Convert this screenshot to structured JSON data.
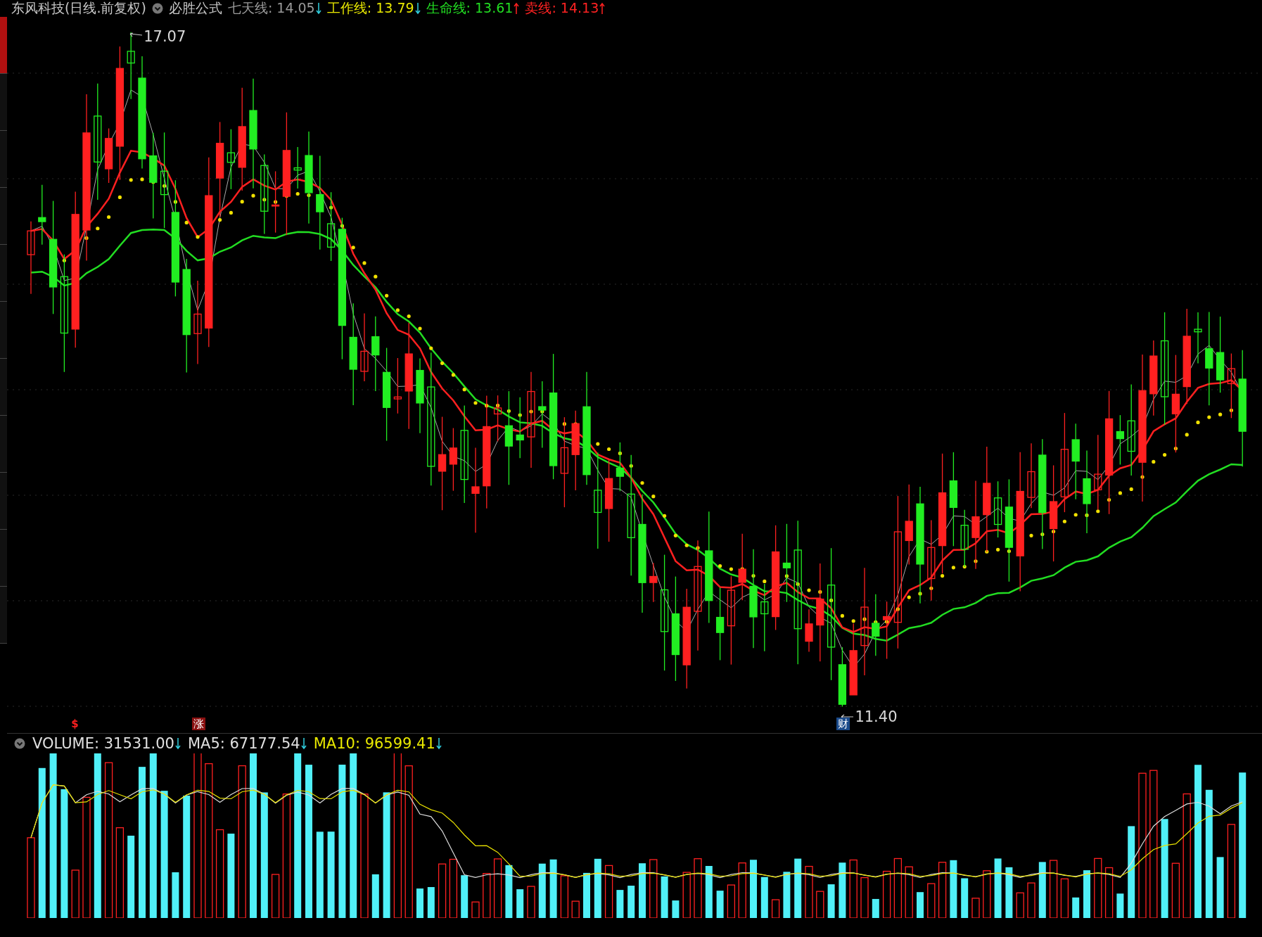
{
  "header": {
    "title": "东风科技(日线.前复权)",
    "indicator": "必胜公式",
    "readings": [
      {
        "label": "七天线: 14.05",
        "rising": false,
        "color": "#9a9a9a"
      },
      {
        "label": "工作线: 13.79",
        "rising": false,
        "color": "#e8e800"
      },
      {
        "label": "生命线: 13.61",
        "rising": true,
        "color": "#22dd22"
      },
      {
        "label": "卖线: 14.13",
        "rising": true,
        "color": "#ff2222"
      }
    ]
  },
  "price_chart": {
    "high_label": "17.07",
    "low_label": "11.40",
    "markers": [
      {
        "text": "$",
        "kind": "signal"
      },
      {
        "text": "涨",
        "kind": "limit"
      },
      {
        "text": "财",
        "kind": "report"
      }
    ]
  },
  "volume": {
    "readings": [
      {
        "label": "VOLUME: 31531.00",
        "rising": false,
        "color": "#e0e0e0"
      },
      {
        "label": "MA5: 67177.54",
        "rising": false,
        "color": "#e0e0e0"
      },
      {
        "label": "MA10: 96599.41",
        "rising": false,
        "color": "#e8e800"
      }
    ]
  }
}
